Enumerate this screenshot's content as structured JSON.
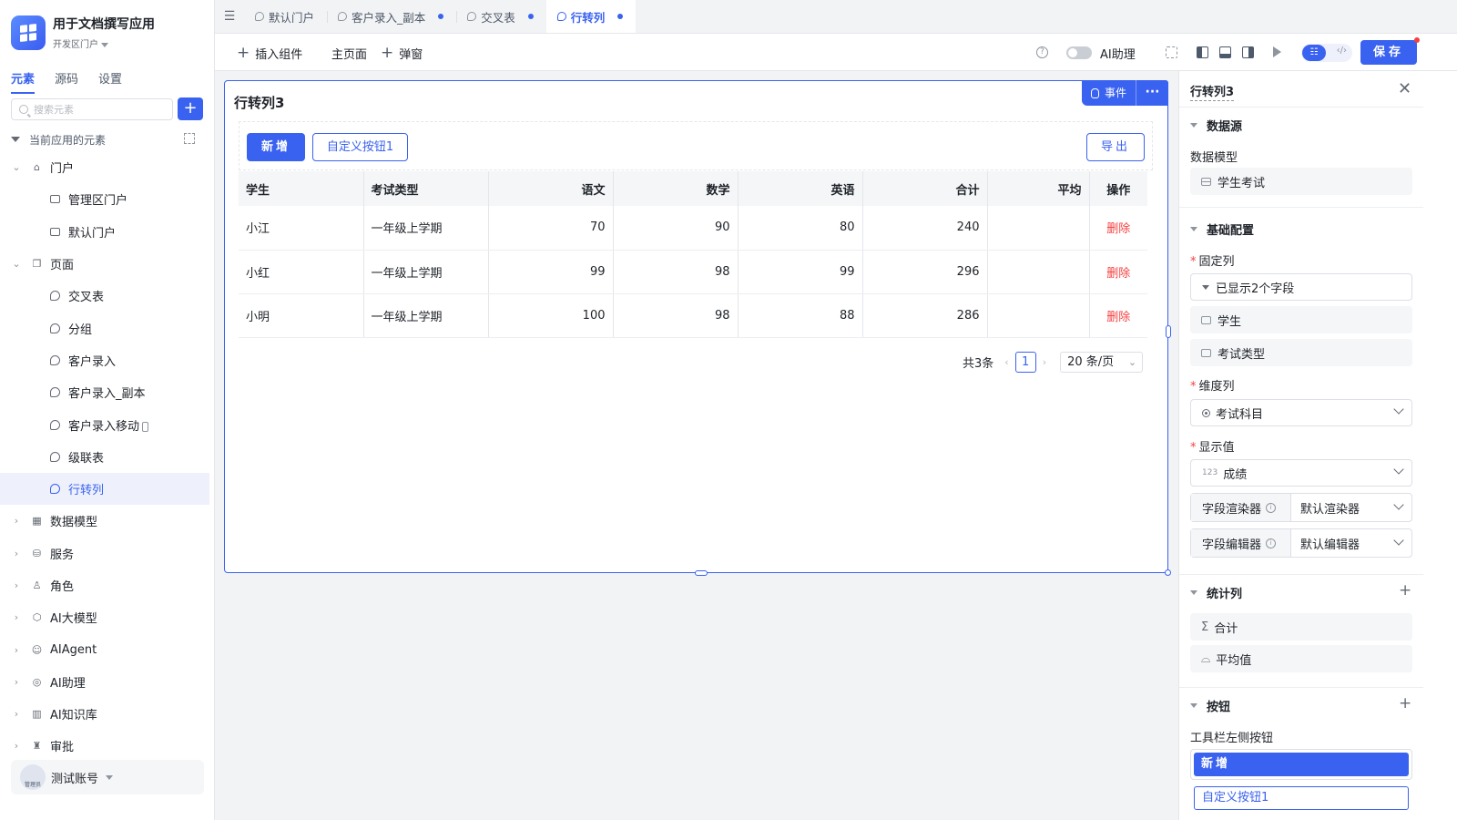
{
  "app": {
    "title": "用于文档撰写应用",
    "subtitle": "开发区门户"
  },
  "sidebar": {
    "tabs": [
      {
        "label": "元素",
        "active": true
      },
      {
        "label": "源码",
        "active": false
      },
      {
        "label": "设置",
        "active": false
      }
    ],
    "search_placeholder": "搜索元素",
    "tree_header": "当前应用的元素",
    "tree": [
      {
        "label": "门户",
        "level": 0,
        "expanded": true,
        "icon": "home-icon"
      },
      {
        "label": "管理区门户",
        "level": 1,
        "icon": "portal-icon"
      },
      {
        "label": "默认门户",
        "level": 1,
        "icon": "portal-icon"
      },
      {
        "label": "页面",
        "level": 0,
        "expanded": true,
        "icon": "pages-icon"
      },
      {
        "label": "交叉表",
        "level": 1,
        "icon": "page-icon"
      },
      {
        "label": "分组",
        "level": 1,
        "icon": "page-icon"
      },
      {
        "label": "客户录入",
        "level": 1,
        "icon": "page-icon"
      },
      {
        "label": "客户录入_副本",
        "level": 1,
        "icon": "page-icon"
      },
      {
        "label": "客户录入移动",
        "level": 1,
        "icon": "page-icon",
        "mobile": true
      },
      {
        "label": "级联表",
        "level": 1,
        "icon": "page-icon"
      },
      {
        "label": "行转列",
        "level": 1,
        "icon": "page-icon",
        "selected": true
      },
      {
        "label": "数据模型",
        "level": 0,
        "expanded": false,
        "icon": "table-icon"
      },
      {
        "label": "服务",
        "level": 0,
        "expanded": false,
        "icon": "service-icon"
      },
      {
        "label": "角色",
        "level": 0,
        "expanded": false,
        "icon": "role-icon"
      },
      {
        "label": "AI大模型",
        "level": 0,
        "expanded": false,
        "icon": "cube-icon"
      },
      {
        "label": "AIAgent",
        "level": 0,
        "expanded": false,
        "icon": "robot-icon"
      },
      {
        "label": "AI助理",
        "level": 0,
        "expanded": false,
        "icon": "ai-icon"
      },
      {
        "label": "AI知识库",
        "level": 0,
        "expanded": false,
        "icon": "book-icon"
      },
      {
        "label": "审批",
        "level": 0,
        "expanded": false,
        "icon": "stamp-icon"
      }
    ],
    "user": {
      "name": "测试账号",
      "role_badge": "管理员"
    }
  },
  "tabs": [
    {
      "label": "默认门户",
      "active": false,
      "dirty": false
    },
    {
      "label": "客户录入_副本",
      "active": false,
      "dirty": true
    },
    {
      "label": "交叉表",
      "active": false,
      "dirty": true
    },
    {
      "label": "行转列",
      "active": true,
      "dirty": true
    }
  ],
  "toolbar": {
    "insert": "插入组件",
    "main_page": "主页面",
    "popup": "弹窗",
    "ai_label": "AI助理",
    "save": "保存"
  },
  "component": {
    "title": "行转列3",
    "event_btn": "事件",
    "more_btn": "···",
    "btn_add": "新增",
    "btn_custom": "自定义按钮1",
    "btn_export": "导出",
    "columns": [
      "学生",
      "考试类型",
      "语文",
      "数学",
      "英语",
      "合计",
      "平均",
      "操作"
    ],
    "rows": [
      {
        "student": "小江",
        "type": "一年级上学期",
        "chinese": "70",
        "math": "90",
        "english": "80",
        "total": "240",
        "avg": "",
        "op": "删除"
      },
      {
        "student": "小红",
        "type": "一年级上学期",
        "chinese": "99",
        "math": "98",
        "english": "99",
        "total": "296",
        "avg": "",
        "op": "删除"
      },
      {
        "student": "小明",
        "type": "一年级上学期",
        "chinese": "100",
        "math": "98",
        "english": "88",
        "total": "286",
        "avg": "",
        "op": "删除"
      }
    ],
    "pager": {
      "total": "共3条",
      "current": "1",
      "size": "20 条/页"
    }
  },
  "panel": {
    "title": "行转列3",
    "datasource": {
      "section": "数据源",
      "model_label": "数据模型",
      "model_value": "学生考试"
    },
    "basic": {
      "section": "基础配置",
      "fixed_label": "固定列",
      "fixed_value": "已显示2个字段",
      "fixed_fields": [
        "学生",
        "考试类型"
      ],
      "dim_label": "维度列",
      "dim_value": "考试科目",
      "value_label": "显示值",
      "value_value": "成绩",
      "value_prefix": "123",
      "renderer_label": "字段渲染器",
      "renderer_value": "默认渲染器",
      "editor_label": "字段编辑器",
      "editor_value": "默认编辑器"
    },
    "stats": {
      "section": "统计列",
      "items": [
        "合计",
        "平均值"
      ]
    },
    "buttons": {
      "section": "按钮",
      "left_label": "工具栏左侧按钮",
      "items": [
        "新增",
        "自定义按钮1"
      ]
    }
  },
  "colors": {
    "primary": "#3a62f0",
    "danger": "#f53f3f"
  }
}
